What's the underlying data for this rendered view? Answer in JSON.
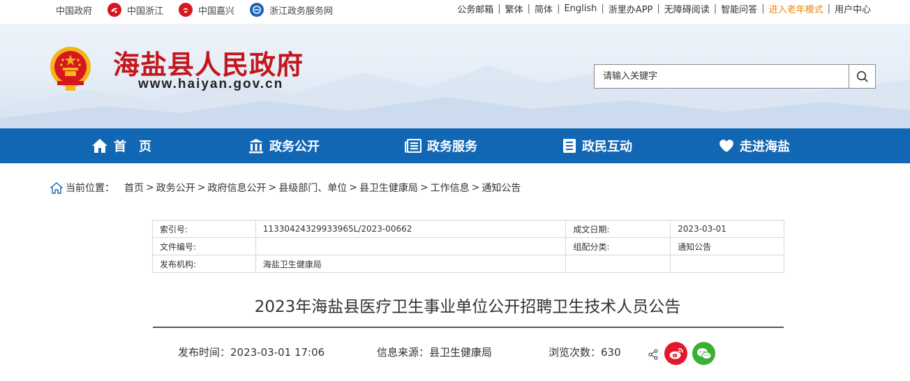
{
  "topbar": {
    "links": [
      {
        "label": "中国政府",
        "icon": "none"
      },
      {
        "label": "中国浙江",
        "icon": "zhejiang-logo-icon"
      },
      {
        "label": "中国嘉兴",
        "icon": "jiaxing-logo-icon"
      },
      {
        "label": "浙江政务服务网",
        "icon": "zjzwfw-logo-icon"
      }
    ],
    "right": [
      "公务邮箱",
      "繁体",
      "简体",
      "English",
      "浙里办APP",
      "无障碍阅读",
      "智能问答",
      "进入老年模式",
      "用户中心"
    ],
    "elder_color": "#e8870f"
  },
  "header": {
    "title": "海盐县人民政府",
    "url": "www.haiyan.gov.cn",
    "title_color": "#c4161c",
    "search_placeholder": "请输入关键字"
  },
  "nav": {
    "color": "#1267b5",
    "items": [
      {
        "label": "首　页",
        "icon": "home-icon"
      },
      {
        "label": "政务公开",
        "icon": "building-icon"
      },
      {
        "label": "政务服务",
        "icon": "newspaper-icon"
      },
      {
        "label": "政民互动",
        "icon": "document-list-icon"
      },
      {
        "label": "走进海盐",
        "icon": "heart-icon"
      }
    ]
  },
  "breadcrumb": {
    "label": "当前位置：",
    "items": [
      "首页",
      "政务公开",
      "政府信息公开",
      "县级部门、单位",
      "县卫生健康局",
      "工作信息",
      "通知公告"
    ]
  },
  "meta": {
    "rows": [
      {
        "k1": "索引号:",
        "v1": "11330424329933965L/2023-00662",
        "k2": "成文日期:",
        "v2": "2023-03-01"
      },
      {
        "k1": "文件编号:",
        "v1": "",
        "k2": "组配分类:",
        "v2": "通知公告"
      },
      {
        "k1": "发布机构:",
        "v1": "海盐卫生健康局",
        "k2": "",
        "v2": ""
      }
    ]
  },
  "article": {
    "title": "2023年海盐县医疗卫生事业单位公开招聘卫生技术人员公告",
    "publish_time": "发布时间：2023-03-01 17:06",
    "source": "信息来源：县卫生健康局",
    "views": "浏览次数：630"
  }
}
